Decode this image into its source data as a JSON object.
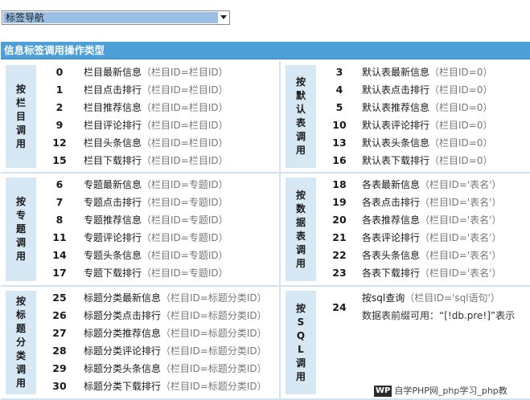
{
  "nav_select": {
    "value": "标签导航"
  },
  "panel": {
    "title": "信息标签调用操作类型"
  },
  "groups": {
    "by_column": {
      "side_label": "按栏目调用",
      "rows": [
        {
          "code": "0",
          "label": "栏目最新信息",
          "param": "（栏目ID=栏目ID）"
        },
        {
          "code": "1",
          "label": "栏目点击排行",
          "param": "（栏目ID=栏目ID）"
        },
        {
          "code": "2",
          "label": "栏目推荐信息",
          "param": "（栏目ID=栏目ID）"
        },
        {
          "code": "9",
          "label": "栏目评论排行",
          "param": "（栏目ID=栏目ID）"
        },
        {
          "code": "12",
          "label": "栏目头条信息",
          "param": "（栏目ID=栏目ID）"
        },
        {
          "code": "15",
          "label": "栏目下载排行",
          "param": "（栏目ID=栏目ID）"
        }
      ]
    },
    "by_default_table": {
      "side_label": "按默认表调用",
      "rows": [
        {
          "code": "3",
          "label": "默认表最新信息",
          "param": "（栏目ID=0）"
        },
        {
          "code": "4",
          "label": "默认表点击排行",
          "param": "（栏目ID=0）"
        },
        {
          "code": "5",
          "label": "默认表推荐信息",
          "param": "（栏目ID=0）"
        },
        {
          "code": "10",
          "label": "默认表评论排行",
          "param": "（栏目ID=0）"
        },
        {
          "code": "13",
          "label": "默认表头条信息",
          "param": "（栏目ID=0）"
        },
        {
          "code": "16",
          "label": "默认表下载排行",
          "param": "（栏目ID=0）"
        }
      ]
    },
    "by_topic": {
      "side_label": "按专题调用",
      "rows": [
        {
          "code": "6",
          "label": "专题最新信息",
          "param": "（栏目ID=专题ID）"
        },
        {
          "code": "7",
          "label": "专题点击排行",
          "param": "（栏目ID=专题ID）"
        },
        {
          "code": "8",
          "label": "专题推荐信息",
          "param": "（栏目ID=专题ID）"
        },
        {
          "code": "11",
          "label": "专题评论排行",
          "param": "（栏目ID=专题ID）"
        },
        {
          "code": "14",
          "label": "专题头条信息",
          "param": "（栏目ID=专题ID）"
        },
        {
          "code": "17",
          "label": "专题下载排行",
          "param": "（栏目ID=专题ID）"
        }
      ]
    },
    "by_data_table": {
      "side_label": "按数据表调用",
      "rows": [
        {
          "code": "18",
          "label": "各表最新信息",
          "param": "（栏目ID='表名'）"
        },
        {
          "code": "19",
          "label": "各表点击排行",
          "param": "（栏目ID='表名'）"
        },
        {
          "code": "20",
          "label": "各表推荐信息",
          "param": "（栏目ID='表名'）"
        },
        {
          "code": "21",
          "label": "各表评论排行",
          "param": "（栏目ID='表名'）"
        },
        {
          "code": "22",
          "label": "各表头条信息",
          "param": "（栏目ID='表名'）"
        },
        {
          "code": "23",
          "label": "各表下载排行",
          "param": "（栏目ID='表名'）"
        }
      ]
    },
    "by_title_category": {
      "side_label": "按标题分类调用",
      "rows": [
        {
          "code": "25",
          "label": "标题分类最新信息",
          "param": "（栏目ID=标题分类ID）"
        },
        {
          "code": "26",
          "label": "标题分类点击排行",
          "param": "（栏目ID=标题分类ID）"
        },
        {
          "code": "27",
          "label": "标题分类推荐信息",
          "param": "（栏目ID=标题分类ID）"
        },
        {
          "code": "28",
          "label": "标题分类评论排行",
          "param": "（栏目ID=标题分类ID）"
        },
        {
          "code": "29",
          "label": "标题分类头条信息",
          "param": "（栏目ID=标题分类ID）"
        },
        {
          "code": "30",
          "label": "标题分类下载排行",
          "param": "（栏目ID=标题分类ID）"
        }
      ]
    },
    "by_sql": {
      "side_label": "按SQL调用",
      "code": "24",
      "label": "按sql查询",
      "param": "（栏目ID='sql语句'）",
      "note": "数据表前缀可用：“[!db.pre!]”表示"
    }
  },
  "watermark": {
    "logo": "WP",
    "text": "自学PHP网_php学习_php教"
  }
}
